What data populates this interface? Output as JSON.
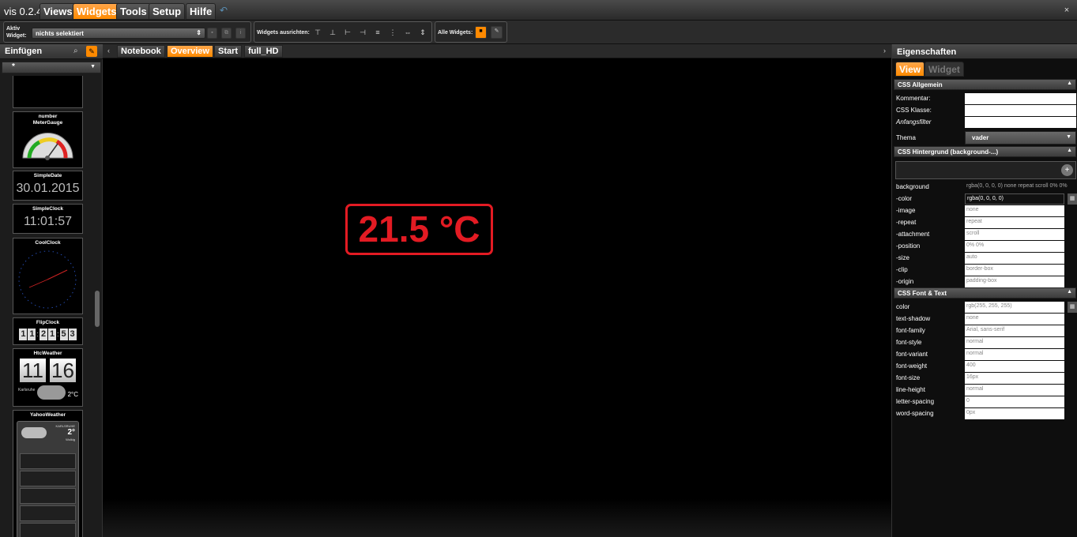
{
  "app": {
    "title": "vis 0.2.4",
    "close_icon": "×"
  },
  "menu": {
    "views": "Views",
    "widgets": "Widgets",
    "tools": "Tools",
    "setup": "Setup",
    "hilfe": "Hilfe"
  },
  "toolbar": {
    "active_widget_label_1": "Aktiv",
    "active_widget_label_2": "Widget:",
    "active_widget_value": "nichts selektiert",
    "align_label": "Widgets ausrichten:",
    "all_widgets_label": "Alle Widgets:"
  },
  "left": {
    "title": "Einfügen",
    "filter": "*",
    "widgets": [
      {
        "name": "number"
      },
      {
        "name": "MeterGauge"
      },
      {
        "name": "SimpleDate",
        "preview": "30.01.2015"
      },
      {
        "name": "SimpleClock",
        "preview": "11:01:57"
      },
      {
        "name": "CoolClock"
      },
      {
        "name": "FlipClock",
        "digits": [
          "1",
          "1",
          "2",
          "1",
          "5",
          "3"
        ]
      },
      {
        "name": "HtcWeather",
        "hour": "11",
        "minute": "16",
        "city": "Karlsruhe",
        "temp": "2°C"
      },
      {
        "name": "YahooWeather",
        "city": "KARLSRUHE",
        "temp": "2°",
        "condition": "Wolkig"
      }
    ]
  },
  "views": {
    "tabs": [
      "Notebook",
      "Overview",
      "Start",
      "full_HD"
    ],
    "active": "Overview"
  },
  "canvas": {
    "temperature": "21.5 °C",
    "temp_color": "#e31b23"
  },
  "right": {
    "title": "Eigenschaften",
    "tab_view": "View",
    "tab_widget": "Widget",
    "section_general": "CSS Allgemein",
    "general": [
      {
        "label": "Kommentar:",
        "value": ""
      },
      {
        "label": "CSS Klasse:",
        "value": ""
      },
      {
        "label": "Anfangsfilter",
        "value": ""
      }
    ],
    "theme_label": "Thema",
    "theme_value": "vader",
    "section_background": "CSS Hintergrund (background-...)",
    "background": [
      {
        "label": "background",
        "value": "rgba(0, 0, 0, 0) none repeat scroll 0% 0%"
      },
      {
        "label": "-color",
        "value": "rgba(0, 0, 0, 0)"
      },
      {
        "label": "-image",
        "value": "none"
      },
      {
        "label": "-repeat",
        "value": "repeat"
      },
      {
        "label": "-attachment",
        "value": "scroll"
      },
      {
        "label": "-position",
        "value": "0% 0%"
      },
      {
        "label": "-size",
        "value": "auto"
      },
      {
        "label": "-clip",
        "value": "border-box"
      },
      {
        "label": "-origin",
        "value": "padding-box"
      }
    ],
    "section_font": "CSS Font & Text",
    "font": [
      {
        "label": "color",
        "value": "rgb(255, 255, 255)"
      },
      {
        "label": "text-shadow",
        "value": "none"
      },
      {
        "label": "font-family",
        "value": "Arial, sans-serif"
      },
      {
        "label": "font-style",
        "value": "normal"
      },
      {
        "label": "font-variant",
        "value": "normal"
      },
      {
        "label": "font-weight",
        "value": "400"
      },
      {
        "label": "font-size",
        "value": "16px"
      },
      {
        "label": "line-height",
        "value": "normal"
      },
      {
        "label": "letter-spacing",
        "value": "0"
      },
      {
        "label": "word-spacing",
        "value": "0px"
      }
    ]
  },
  "colors": {
    "accent": "#ff8a00",
    "temp_red": "#e31b23"
  }
}
